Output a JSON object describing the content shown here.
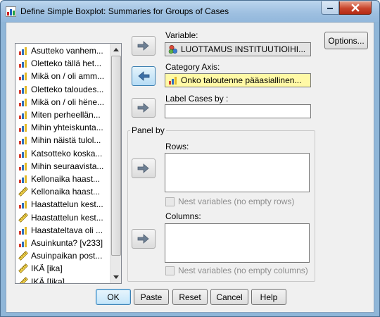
{
  "window": {
    "title": "Define Simple Boxplot: Summaries for Groups of Cases"
  },
  "source_list": {
    "items": [
      {
        "label": "Asutteko vanhem...",
        "icon": "scale-bar-icon"
      },
      {
        "label": "Oletteko tällä het...",
        "icon": "scale-bar-icon"
      },
      {
        "label": "Mikä on / oli amm...",
        "icon": "scale-bar-icon"
      },
      {
        "label": "Oletteko taloudes...",
        "icon": "scale-bar-icon"
      },
      {
        "label": "Mikä on / oli hëne...",
        "icon": "scale-bar-icon"
      },
      {
        "label": "Miten perheellän...",
        "icon": "scale-bar-icon"
      },
      {
        "label": "Mihin yhteiskunta...",
        "icon": "scale-bar-icon"
      },
      {
        "label": "Mihin näistä tulol...",
        "icon": "scale-bar-icon"
      },
      {
        "label": "Katsotteko koska...",
        "icon": "scale-bar-icon"
      },
      {
        "label": "Mihin seuraavista...",
        "icon": "scale-bar-icon"
      },
      {
        "label": "Kellonaika haast...",
        "icon": "scale-bar-icon"
      },
      {
        "label": "Kellonaika haast...",
        "icon": "ruler-icon"
      },
      {
        "label": "Haastattelun kest...",
        "icon": "scale-bar-icon"
      },
      {
        "label": "Haastattelun kest...",
        "icon": "ruler-icon"
      },
      {
        "label": "Haastateltava oli ...",
        "icon": "scale-bar-icon"
      },
      {
        "label": "Asuinkunta? [v233]",
        "icon": "scale-bar-icon"
      },
      {
        "label": "Asuinpaikan post...",
        "icon": "ruler-icon"
      },
      {
        "label": "IKÄ [ika]",
        "icon": "ruler-icon"
      },
      {
        "label": "IKÄ [Iika]",
        "icon": "ruler-icon"
      }
    ]
  },
  "variable": {
    "label": "Variable:",
    "value": "LUOTTAMUS INSTITUUTIOIHI..."
  },
  "category_axis": {
    "label": "Category Axis:",
    "value": "Onko taloutenne pääasiallinen..."
  },
  "label_cases": {
    "label": "Label Cases by :",
    "value": ""
  },
  "panel": {
    "title": "Panel by",
    "rows_label": "Rows:",
    "rows_nest_label": "Nest variables (no empty rows)",
    "columns_label": "Columns:",
    "columns_nest_label": "Nest variables (no empty columns)"
  },
  "buttons": {
    "options": "Options...",
    "ok": "OK",
    "paste": "Paste",
    "reset": "Reset",
    "cancel": "Cancel",
    "help": "Help"
  },
  "colors": {
    "title_bar": "#9dbfe0",
    "close_button": "#c8442b",
    "category_field": "#fff9a6",
    "variable_field": "#e3e3e3"
  }
}
